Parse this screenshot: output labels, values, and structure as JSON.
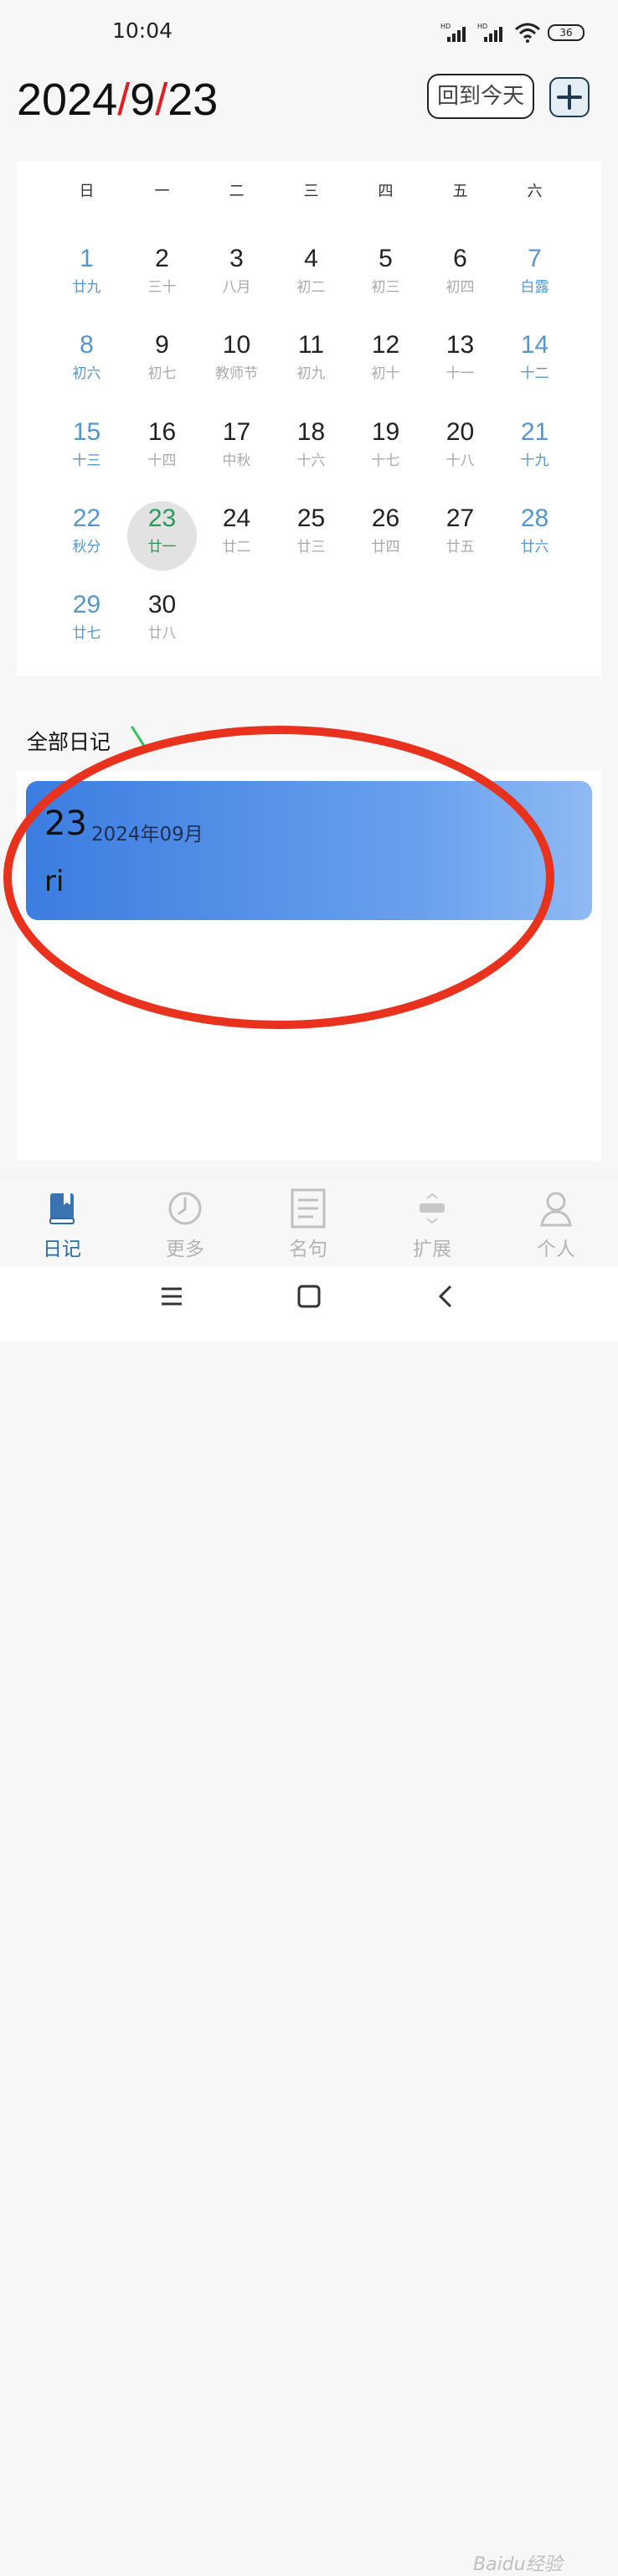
{
  "status_bar": {
    "time": "10:04",
    "battery": "36"
  },
  "header": {
    "date_year": "2024",
    "date_month": "9",
    "date_day": "23",
    "separator": "/",
    "today_button": "回到今天"
  },
  "calendar": {
    "weekdays": [
      "日",
      "一",
      "二",
      "三",
      "四",
      "五",
      "六"
    ],
    "selected_day": "23",
    "days": [
      {
        "num": "1",
        "lunar": "廿九"
      },
      {
        "num": "2",
        "lunar": "三十"
      },
      {
        "num": "3",
        "lunar": "八月"
      },
      {
        "num": "4",
        "lunar": "初二"
      },
      {
        "num": "5",
        "lunar": "初三"
      },
      {
        "num": "6",
        "lunar": "初四"
      },
      {
        "num": "7",
        "lunar": "白露"
      },
      {
        "num": "8",
        "lunar": "初六"
      },
      {
        "num": "9",
        "lunar": "初七"
      },
      {
        "num": "10",
        "lunar": "教师节"
      },
      {
        "num": "11",
        "lunar": "初九"
      },
      {
        "num": "12",
        "lunar": "初十"
      },
      {
        "num": "13",
        "lunar": "十一"
      },
      {
        "num": "14",
        "lunar": "十二"
      },
      {
        "num": "15",
        "lunar": "十三"
      },
      {
        "num": "16",
        "lunar": "十四"
      },
      {
        "num": "17",
        "lunar": "中秋"
      },
      {
        "num": "18",
        "lunar": "十六"
      },
      {
        "num": "19",
        "lunar": "十七"
      },
      {
        "num": "20",
        "lunar": "十八"
      },
      {
        "num": "21",
        "lunar": "十九"
      },
      {
        "num": "22",
        "lunar": "秋分"
      },
      {
        "num": "23",
        "lunar": "廿一"
      },
      {
        "num": "24",
        "lunar": "廿二"
      },
      {
        "num": "25",
        "lunar": "廿三"
      },
      {
        "num": "26",
        "lunar": "廿四"
      },
      {
        "num": "27",
        "lunar": "廿五"
      },
      {
        "num": "28",
        "lunar": "廿六"
      },
      {
        "num": "29",
        "lunar": "廿七"
      },
      {
        "num": "30",
        "lunar": "廿八"
      }
    ]
  },
  "diary": {
    "section_title": "全部日记",
    "entries": [
      {
        "day": "23",
        "year_month": "2024年09月",
        "title": "ri"
      }
    ]
  },
  "tabs": [
    {
      "label": "日记",
      "icon": "book-icon",
      "active": true
    },
    {
      "label": "更多",
      "icon": "clock-icon",
      "active": false
    },
    {
      "label": "名句",
      "icon": "document-icon",
      "active": false
    },
    {
      "label": "扩展",
      "icon": "extension-icon",
      "active": false
    },
    {
      "label": "个人",
      "icon": "person-icon",
      "active": false
    }
  ],
  "watermark": "Baidu经验",
  "colors": {
    "accent": "#2a6aa8",
    "weekend": "#5596cf",
    "selected": "#2a9a5a",
    "annotation": "#e8321e",
    "card_start": "#3b7de0",
    "card_end": "#8fbaf4"
  }
}
